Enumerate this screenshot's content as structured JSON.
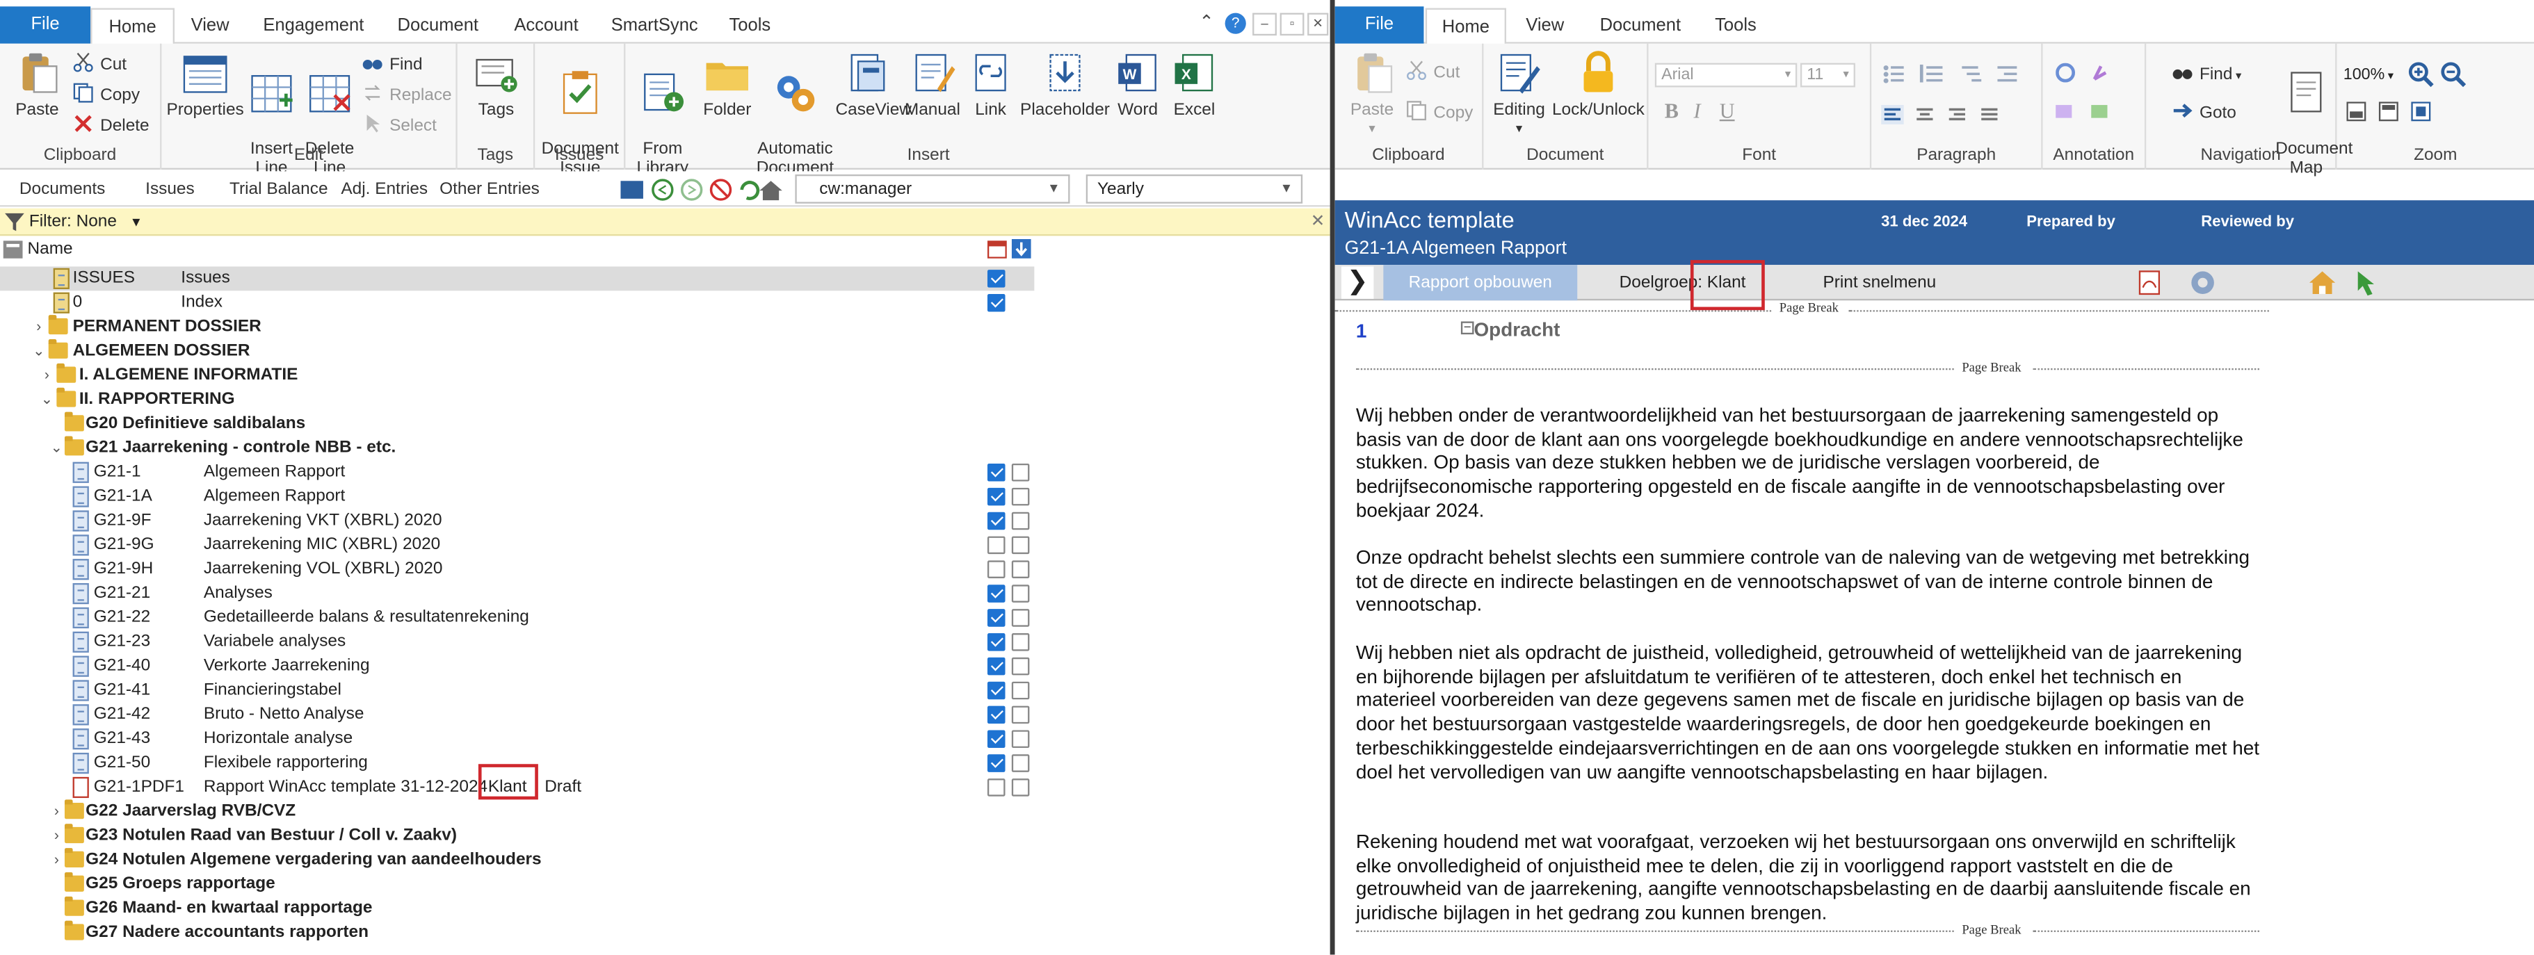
{
  "left": {
    "tabs": {
      "file": "File",
      "home": "Home",
      "view": "View",
      "engagement": "Engagement",
      "document": "Document",
      "account": "Account",
      "smartsync": "SmartSync",
      "tools": "Tools"
    },
    "ribbon": {
      "clipboard": {
        "label": "Clipboard",
        "paste": "Paste",
        "cut": "Cut",
        "copy": "Copy",
        "delete": "Delete"
      },
      "edit": {
        "label": "Edit",
        "properties": "Properties",
        "insert_line": "Insert\nLine",
        "delete_line": "Delete\nLine",
        "find": "Find",
        "replace": "Replace",
        "select": "Select"
      },
      "tags": {
        "label": "Tags",
        "tags": "Tags"
      },
      "issues": {
        "label": "Issues",
        "document_issue": "Document\nIssue"
      },
      "insert": {
        "label": "Insert",
        "from_library": "From\nLibrary",
        "folder": "Folder",
        "automatic_document": "Automatic\nDocument",
        "caseview": "CaseView",
        "manual": "Manual",
        "link": "Link",
        "placeholder": "Placeholder",
        "word": "Word",
        "excel": "Excel"
      }
    },
    "nav": {
      "documents": "Documents",
      "issues": "Issues",
      "trial_balance": "Trial Balance",
      "adj_entries": "Adj. Entries",
      "other_entries": "Other Entries",
      "user": "cw:manager",
      "period": "Yearly"
    },
    "filter": "Filter: None",
    "tree_header": "Name",
    "rows": [
      {
        "code": "ISSUES",
        "desc": "Issues",
        "check": true,
        "selected": true
      },
      {
        "code": "0",
        "desc": "Index",
        "check": true
      },
      {
        "name": "PERMANENT DOSSIER"
      },
      {
        "name": "ALGEMEEN DOSSIER"
      },
      {
        "name": "I. ALGEMENE INFORMATIE"
      },
      {
        "name": "II. RAPPORTERING"
      },
      {
        "name": "G20 Definitieve saldibalans"
      },
      {
        "name": "G21 Jaarrekening - controle NBB - etc."
      },
      {
        "code": "G21-1",
        "desc": "Algemeen Rapport",
        "c1": true,
        "c2": false
      },
      {
        "code": "G21-1A",
        "desc": "Algemeen Rapport",
        "c1": true,
        "c2": false
      },
      {
        "code": "G21-9F",
        "desc": "Jaarrekening VKT (XBRL) 2020",
        "c1": true,
        "c2": false
      },
      {
        "code": "G21-9G",
        "desc": "Jaarrekening MIC (XBRL) 2020",
        "c1": false,
        "c2": false
      },
      {
        "code": "G21-9H",
        "desc": "Jaarrekening VOL (XBRL) 2020",
        "c1": false,
        "c2": false
      },
      {
        "code": "G21-21",
        "desc": "Analyses",
        "c1": true,
        "c2": false
      },
      {
        "code": "G21-22",
        "desc": "Gedetailleerde balans & resultatenrekening",
        "c1": true,
        "c2": false
      },
      {
        "code": "G21-23",
        "desc": "Variabele analyses",
        "c1": true,
        "c2": false
      },
      {
        "code": "G21-40",
        "desc": "Verkorte Jaarrekening",
        "c1": true,
        "c2": false
      },
      {
        "code": "G21-41",
        "desc": "Financieringstabel",
        "c1": true,
        "c2": false
      },
      {
        "code": "G21-42",
        "desc": "Bruto - Netto Analyse",
        "c1": true,
        "c2": false
      },
      {
        "code": "G21-43",
        "desc": "Horizontale analyse",
        "c1": true,
        "c2": false
      },
      {
        "code": "G21-50",
        "desc": "Flexibele rapportering",
        "c1": true,
        "c2": false
      },
      {
        "code": "G21-1PDF1",
        "desc": "Rapport WinAcc template 31-12-2024",
        "tag": "Klant",
        "status": "Draft",
        "c1": false,
        "c2": false
      },
      {
        "name": "G22 Jaarverslag RVB/CVZ"
      },
      {
        "name": "G23 Notulen Raad van Bestuur / Coll v. Zaakv)"
      },
      {
        "name": "G24 Notulen Algemene vergadering van aandeelhouders"
      },
      {
        "name": "G25 Groeps rapportage"
      },
      {
        "name": "G26 Maand- en kwartaal rapportage"
      },
      {
        "name": "G27 Nadere accountants rapporten"
      }
    ]
  },
  "right": {
    "tabs": {
      "file": "File",
      "home": "Home",
      "view": "View",
      "document": "Document",
      "tools": "Tools"
    },
    "ribbon": {
      "clipboard": {
        "label": "Clipboard",
        "paste": "Paste",
        "cut": "Cut",
        "copy": "Copy"
      },
      "document": {
        "label": "Document",
        "editing": "Editing",
        "lock": "Lock/Unlock"
      },
      "font": {
        "label": "Font",
        "name": "Arial",
        "size": "11",
        "bold": "B",
        "italic": "I",
        "underline": "U"
      },
      "paragraph": {
        "label": "Paragraph"
      },
      "annotation": {
        "label": "Annotation"
      },
      "navigation": {
        "label": "Navigation",
        "find": "Find",
        "goto": "Goto",
        "document_map": "Document\nMap"
      },
      "zoom": {
        "label": "Zoom",
        "value": "100%"
      }
    },
    "header": {
      "title": "WinAcc template",
      "date": "31 dec 2024",
      "prepared": "Prepared by",
      "reviewed": "Reviewed by",
      "subtitle": "G21-1A Algemeen Rapport"
    },
    "toolbar": {
      "build": "Rapport opbouwen",
      "target": "Doelgroep: Klant",
      "print": "Print snelmenu"
    },
    "page_break": "Page Break",
    "section_number": "1",
    "section_title": "Opdracht",
    "paragraphs": [
      "Wij hebben onder de verantwoordelijkheid van het bestuursorgaan de jaarrekening samengesteld op basis van de door de klant aan ons voorgelegde boekhoudkundige en andere vennootschapsrechtelijke stukken. Op basis van deze stukken hebben we de juridische verslagen voorbereid, de bedrijfseconomische rapportering opgesteld en de fiscale aangifte in de vennootschapsbelasting over boekjaar 2024.",
      "Onze opdracht behelst slechts een summiere controle van de naleving van de wetgeving met betrekking tot de directe en indirecte belastingen en de vennootschapswet of van de interne controle binnen de vennootschap.",
      "Wij hebben niet als opdracht de juistheid, volledigheid, getrouwheid of wettelijkheid van de jaarrekening en bijhorende bijlagen per afsluitdatum te verifiëren of te attesteren, doch enkel het technisch en materieel voorbereiden van deze gegevens samen met de fiscale en juridische bijlagen op basis van de door het bestuursorgaan vastgestelde waarderingsregels, de door hen goedgekeurde boekingen en terbeschikkinggestelde eindejaarsverrichtingen en de aan ons voorgelegde stukken en informatie met het doel het vervolledigen van uw aangifte vennootschapsbelasting en haar bijlagen.",
      "Rekening houdend met wat voorafgaat, verzoeken wij het bestuursorgaan ons onverwijld en schriftelijk elke onvolledigheid of onjuistheid mee te delen, die zij in voorliggend rapport vaststelt en die de getrouwheid van de jaarrekening, aangifte vennootschapsbelasting en de daarbij aansluitende fiscale en juridische bijlagen in het gedrang zou kunnen brengen."
    ]
  }
}
